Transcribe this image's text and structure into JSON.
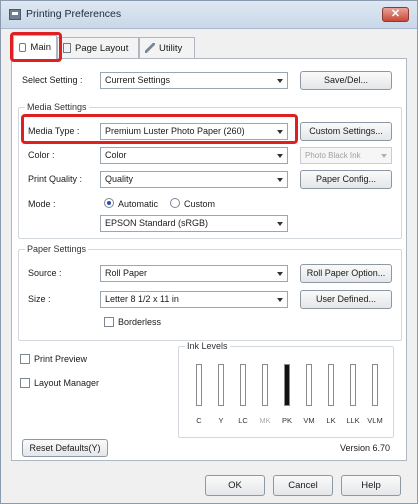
{
  "window": {
    "title": "Printing Preferences",
    "close_glyph": "✕"
  },
  "tabs": [
    {
      "label": "Main",
      "icon": "printer-icon"
    },
    {
      "label": "Page Layout",
      "icon": "page-icon"
    },
    {
      "label": "Utility",
      "icon": "wrench-icon"
    }
  ],
  "select_setting": {
    "label": "Select Setting :",
    "value": "Current Settings",
    "button": "Save/Del..."
  },
  "media_settings": {
    "group_title": "Media Settings",
    "media_type_label": "Media Type :",
    "media_type_value": "Premium Luster Photo Paper (260)",
    "custom_button": "Custom Settings...",
    "color_label": "Color :",
    "color_value": "Color",
    "black_ink_value": "Photo Black Ink",
    "quality_label": "Print Quality :",
    "quality_value": "Quality",
    "paper_config_button": "Paper Config...",
    "mode_label": "Mode :",
    "mode_automatic": "Automatic",
    "mode_custom": "Custom",
    "mode_selected": "Automatic",
    "mode_profile": "EPSON Standard (sRGB)"
  },
  "paper_settings": {
    "group_title": "Paper Settings",
    "source_label": "Source :",
    "source_value": "Roll Paper",
    "roll_option_button": "Roll Paper Option...",
    "size_label": "Size :",
    "size_value": "Letter 8 1/2 x 11 in",
    "user_defined_button": "User Defined...",
    "borderless_label": "Borderless"
  },
  "options": {
    "print_preview": "Print Preview",
    "layout_manager": "Layout Manager"
  },
  "ink_levels": {
    "title": "Ink Levels",
    "inks": [
      {
        "label": "C",
        "level": 0.0,
        "color": "#3fb6e6"
      },
      {
        "label": "Y",
        "level": 0.0,
        "color": "#f0dc22"
      },
      {
        "label": "LC",
        "level": 0.0,
        "color": "#8fd4f0"
      },
      {
        "label": "MK",
        "level": 0.0,
        "color": "#222222",
        "dimmed": true
      },
      {
        "label": "PK",
        "level": 1.0,
        "color": "#111111"
      },
      {
        "label": "VM",
        "level": 0.0,
        "color": "#d43c8a"
      },
      {
        "label": "LK",
        "level": 0.0,
        "color": "#7a7a7a"
      },
      {
        "label": "LLK",
        "level": 0.0,
        "color": "#b8b8b8"
      },
      {
        "label": "VLM",
        "level": 0.0,
        "color": "#ef9ac4"
      }
    ]
  },
  "footer": {
    "reset_button": "Reset Defaults(Y)",
    "version": "Version 6.70"
  },
  "dialog_buttons": {
    "ok": "OK",
    "cancel": "Cancel",
    "help": "Help"
  },
  "colors": {
    "highlight": "#e02020",
    "accent": "#2a4fa8"
  }
}
